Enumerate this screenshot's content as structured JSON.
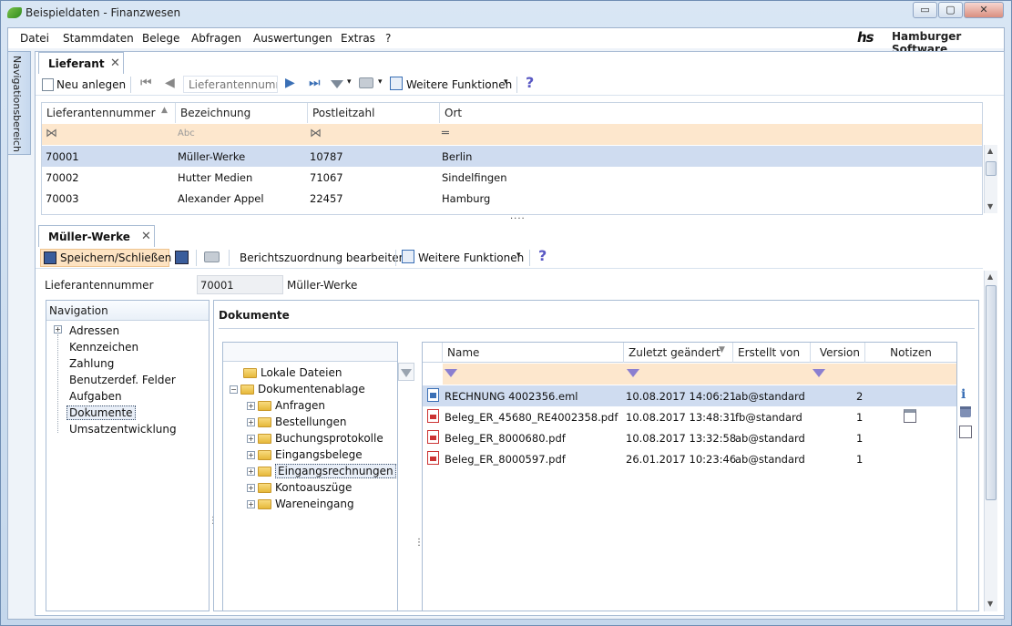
{
  "window": {
    "title": "Beispieldaten - Finanzwesen",
    "min": "▭",
    "max": "▢",
    "close": "✕"
  },
  "menu": {
    "items": [
      "Datei",
      "Stammdaten",
      "Belege",
      "Abfragen",
      "Auswertungen",
      "Extras",
      "?"
    ],
    "logo": "Hamburger Software",
    "logo_mark": "hs"
  },
  "nav_strip": {
    "label": "Navigationsbereich"
  },
  "top_tab": {
    "label": "Lieferant"
  },
  "top_toolbar": {
    "new_label": "Neu anlegen",
    "search_placeholder": "Lieferantennumm",
    "more_label": "Weitere Funktionen"
  },
  "supplier_grid": {
    "columns": [
      "Lieferantennummer",
      "Bezeichnung",
      "Postleitzahl",
      "Ort"
    ],
    "rows": [
      {
        "nr": "70001",
        "name": "Müller-Werke",
        "plz": "10787",
        "ort": "Berlin"
      },
      {
        "nr": "70002",
        "name": "Hutter Medien",
        "plz": "71067",
        "ort": "Sindelfingen"
      },
      {
        "nr": "70003",
        "name": "Alexander Appel",
        "plz": "22457",
        "ort": "Hamburg"
      }
    ],
    "selected_row": 0
  },
  "detail_tab": {
    "label": "Müller-Werke"
  },
  "detail_toolbar": {
    "save_close": "Speichern/Schließen",
    "report": "Berichtszuordnung bearbeiten",
    "more_label": "Weitere Funktionen"
  },
  "detail_header": {
    "label": "Lieferantennummer",
    "number": "70001",
    "name": "Müller-Werke"
  },
  "navigation": {
    "title": "Navigation",
    "items": [
      "Adressen",
      "Kennzeichen",
      "Zahlung",
      "Benutzerdef. Felder",
      "Aufgaben",
      "Dokumente",
      "Umsatzentwicklung"
    ],
    "selected": "Dokumente"
  },
  "documents": {
    "title": "Dokumente"
  },
  "tree": {
    "items": [
      {
        "label": "Lokale Dateien",
        "level": 0,
        "expand": ""
      },
      {
        "label": "Dokumentenablage",
        "level": 0,
        "expand": "−"
      },
      {
        "label": "Anfragen",
        "level": 1,
        "expand": "+"
      },
      {
        "label": "Bestellungen",
        "level": 1,
        "expand": "+"
      },
      {
        "label": "Buchungsprotokolle",
        "level": 1,
        "expand": "+"
      },
      {
        "label": "Eingangsbelege",
        "level": 1,
        "expand": "+"
      },
      {
        "label": "Eingangsrechnungen",
        "level": 1,
        "expand": "+"
      },
      {
        "label": "Kontoauszüge",
        "level": 1,
        "expand": "+"
      },
      {
        "label": "Wareneingang",
        "level": 1,
        "expand": "+"
      }
    ],
    "selected": "Eingangsrechnungen"
  },
  "files": {
    "columns": [
      "Name",
      "Zuletzt geändert",
      "Erstellt von",
      "Version",
      "Notizen"
    ],
    "rows": [
      {
        "type": "eml",
        "name": "RECHNUNG 4002356.eml",
        "date": "10.08.2017 14:06:21",
        "user": "ab@standard",
        "version": "2",
        "note": false
      },
      {
        "type": "pdf",
        "name": "Beleg_ER_45680_RE4002358.pdf",
        "date": "10.08.2017 13:48:31",
        "user": "fb@standard",
        "version": "1",
        "note": true
      },
      {
        "type": "pdf",
        "name": "Beleg_ER_8000680.pdf",
        "date": "10.08.2017 13:32:58",
        "user": "ab@standard",
        "version": "1",
        "note": false
      },
      {
        "type": "pdf",
        "name": "Beleg_ER_8000597.pdf",
        "date": "26.01.2017 10:23:46",
        "user": "ab@standard",
        "version": "1",
        "note": false
      }
    ]
  },
  "colors": {
    "selected_row": "#cfdcf0",
    "filter_row": "#fde7cd",
    "accent": "#3a6fb5"
  }
}
